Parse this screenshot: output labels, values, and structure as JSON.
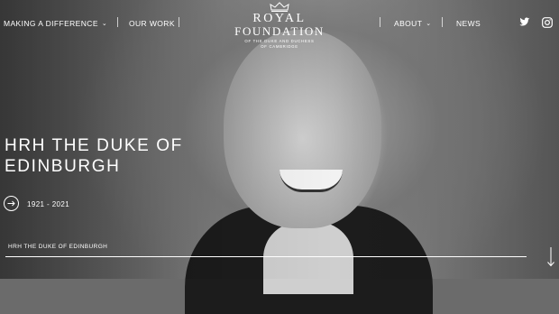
{
  "nav": {
    "left": [
      {
        "label": "MAKING A DIFFERENCE",
        "has_dropdown": true
      },
      {
        "label": "OUR WORK",
        "has_dropdown": false
      }
    ],
    "right": [
      {
        "label": "ABOUT",
        "has_dropdown": true
      },
      {
        "label": "NEWS",
        "has_dropdown": false
      }
    ],
    "social_icons": [
      "twitter-icon",
      "instagram-icon"
    ]
  },
  "logo": {
    "icon": "crown-icon",
    "line1": "ROYAL",
    "line2": "FOUNDATION",
    "sub1": "OF THE DUKE AND DUCHESS",
    "sub2": "OF CAMBRIDGE"
  },
  "hero": {
    "title_line1": "HRH THE DUKE OF",
    "title_line2": "EDINBURGH",
    "years": "1921 - 2021",
    "caption": "HRH THE DUKE OF EDINBURGH"
  },
  "colors": {
    "text": "#ffffff",
    "suit": "#1c1c1c"
  }
}
